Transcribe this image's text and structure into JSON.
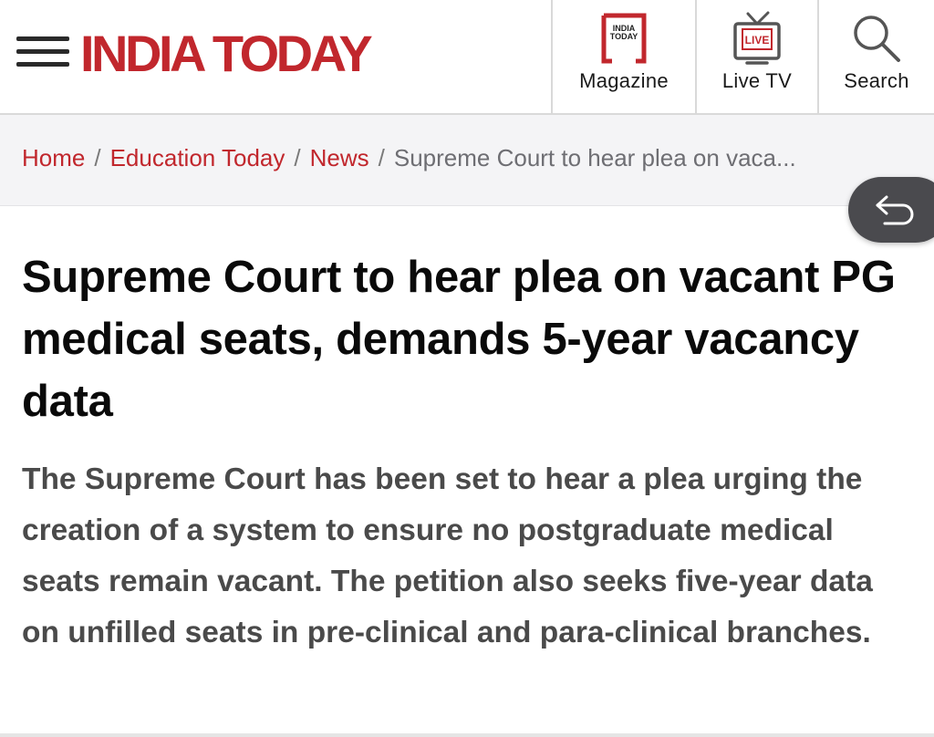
{
  "header": {
    "logo_text": "INDIA TODAY",
    "nav": [
      {
        "label": "Magazine",
        "icon": "magazine-icon",
        "icon_text": [
          "INDIA",
          "TODAY"
        ]
      },
      {
        "label": "Live TV",
        "icon": "live-tv-icon",
        "icon_text": "LIVE"
      },
      {
        "label": "Search",
        "icon": "search-icon"
      }
    ]
  },
  "breadcrumb": {
    "items": [
      "Home",
      "Education Today",
      "News"
    ],
    "separator": "/",
    "current": "Supreme Court to hear plea on vaca..."
  },
  "back_button": {
    "icon": "back-arrow-icon"
  },
  "article": {
    "headline": "Supreme Court to hear plea on vacant PG medical seats, demands 5-year vacancy data",
    "summary": "The Supreme Court has been set to hear a plea urging the creation of a system to ensure no postgraduate medical seats remain vacant. The petition also seeks five-year data on unfilled seats in pre-clinical and para-clinical branches."
  },
  "colors": {
    "brand_red": "#c1272d",
    "breadcrumb_bg": "#f4f4f6",
    "headline": "#0a0a0a",
    "summary": "#4a4a4a"
  }
}
